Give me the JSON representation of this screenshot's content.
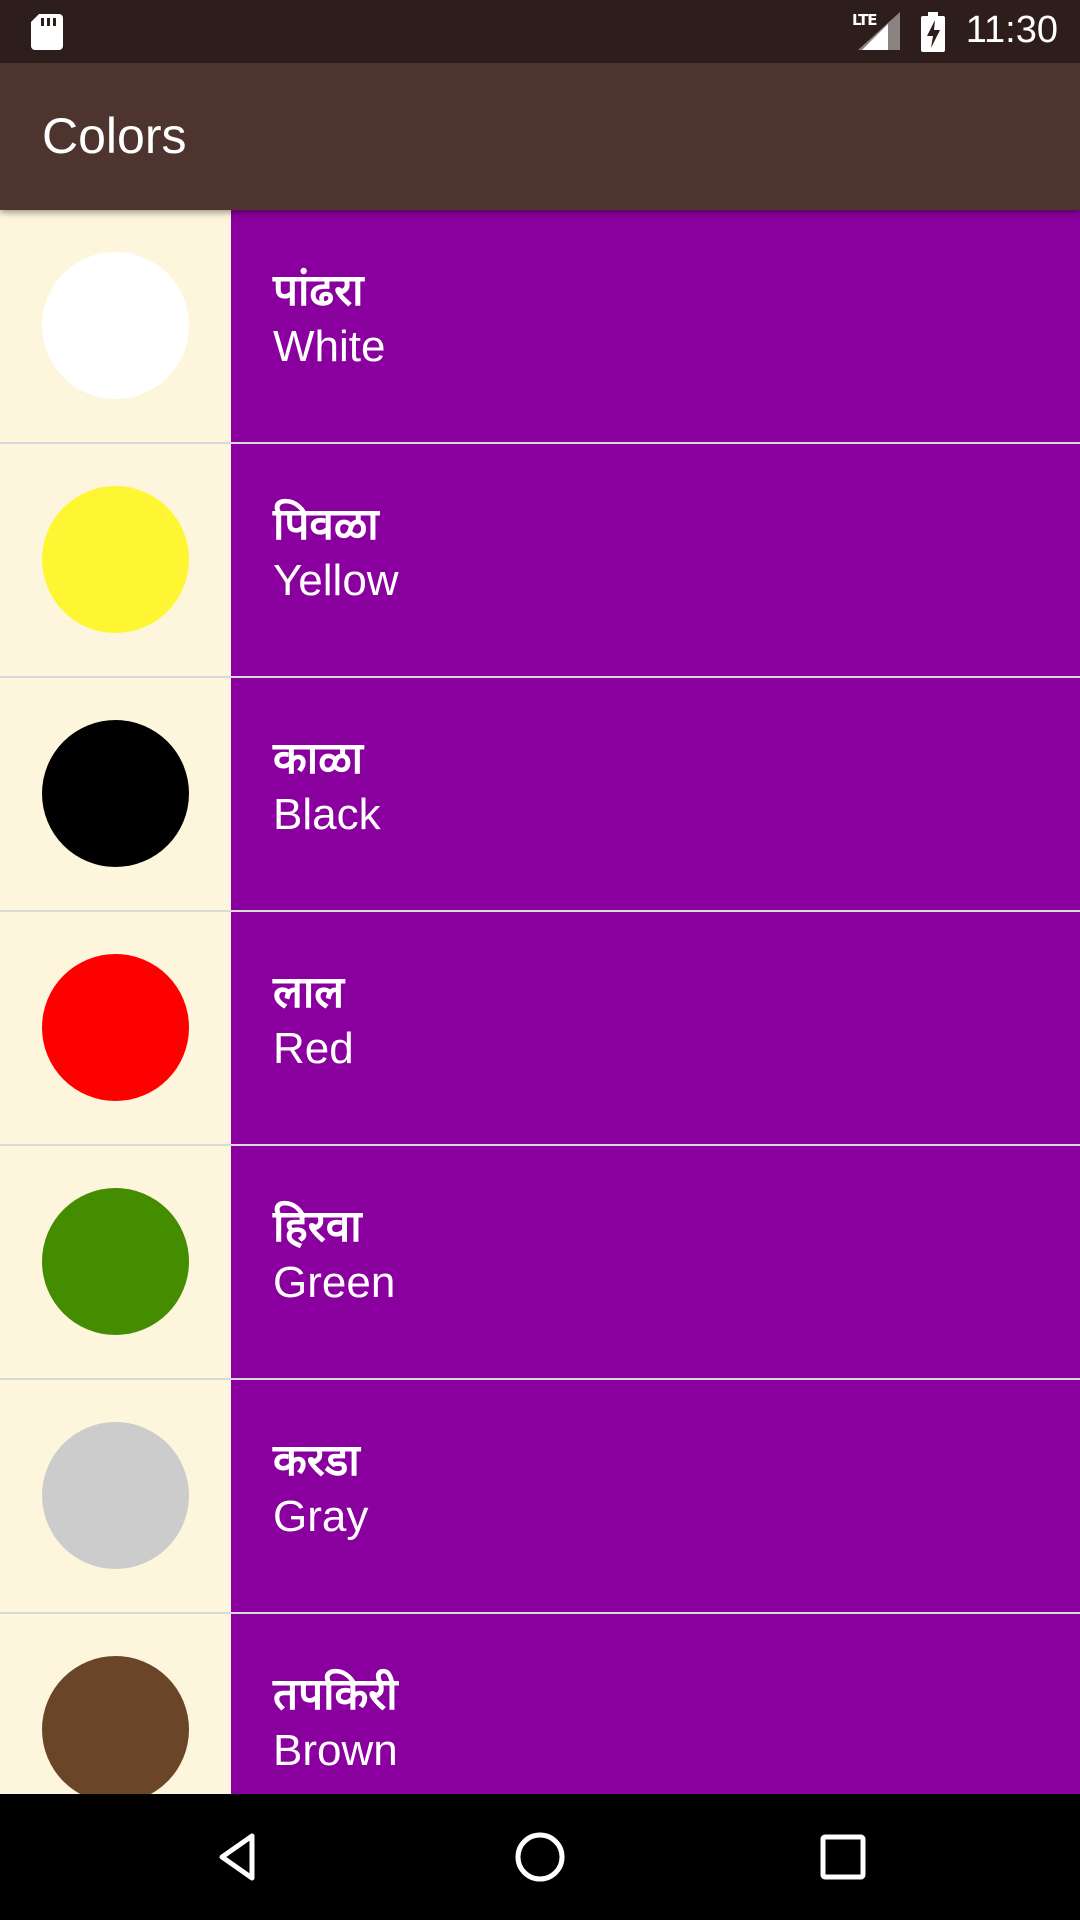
{
  "status_bar": {
    "time": "11:30",
    "network": "LTE",
    "icons": [
      "sd-card-icon",
      "signal-icon",
      "battery-charging-icon"
    ]
  },
  "app_bar": {
    "title": "Colors"
  },
  "colors": [
    {
      "marathi": "पांढरा",
      "english": "White",
      "swatch": "#ffffff"
    },
    {
      "marathi": "पिवळा",
      "english": "Yellow",
      "swatch": "#fff633"
    },
    {
      "marathi": "काळा",
      "english": "Black",
      "swatch": "#000000"
    },
    {
      "marathi": "लाल",
      "english": "Red",
      "swatch": "#ff0000"
    },
    {
      "marathi": "हिरवा",
      "english": "Green",
      "swatch": "#448c00"
    },
    {
      "marathi": "करडा",
      "english": "Gray",
      "swatch": "#cccccc"
    },
    {
      "marathi": "तपकिरी",
      "english": "Brown",
      "swatch": "#6b4527"
    }
  ],
  "theme": {
    "status_bar": "#2d1d1b",
    "app_bar": "#4e342e",
    "row_background": "#8a009e",
    "swatch_background": "#fdf6dc"
  },
  "nav_bar": {
    "icons": [
      "back-icon",
      "home-icon",
      "recents-icon"
    ]
  }
}
